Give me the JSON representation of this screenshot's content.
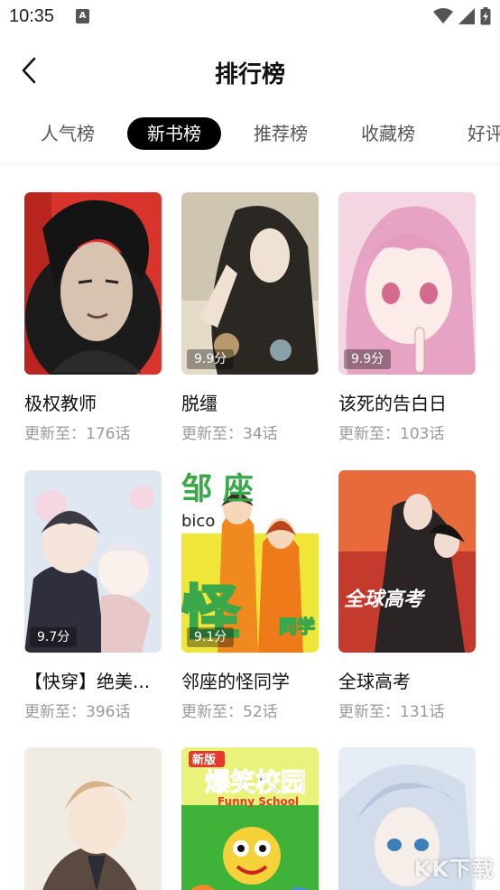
{
  "status_bar": {
    "time": "10:35",
    "notification_icon": "a-icon",
    "icons": [
      "wifi-icon",
      "signal-icon",
      "battery-icon"
    ]
  },
  "header": {
    "back_icon": "back-chevron-icon",
    "title": "排行榜"
  },
  "tabs": [
    {
      "label": "人气榜",
      "active": false
    },
    {
      "label": "新书榜",
      "active": true
    },
    {
      "label": "推荐榜",
      "active": false
    },
    {
      "label": "收藏榜",
      "active": false
    },
    {
      "label": "好评",
      "active": false
    }
  ],
  "comics": [
    {
      "title": "极权教师",
      "chapter": "更新至：176话",
      "score": ""
    },
    {
      "title": "脱缰",
      "chapter": "更新至：34话",
      "score": "9.9分"
    },
    {
      "title": "该死的告白日",
      "chapter": "更新至：103话",
      "score": "9.9分"
    },
    {
      "title": "【快穿】绝美...",
      "chapter": "更新至：396话",
      "score": "9.7分"
    },
    {
      "title": "邻座的怪同学",
      "chapter": "更新至：52话",
      "score": "9.1分"
    },
    {
      "title": "全球高考",
      "chapter": "更新至：131话",
      "score": ""
    },
    {
      "title": "",
      "chapter": "",
      "score": ""
    },
    {
      "title": "",
      "chapter": "",
      "score": ""
    },
    {
      "title": "",
      "chapter": "",
      "score": ""
    }
  ],
  "cover_text": {
    "c5_word": "bico",
    "c5_top": "邹 座",
    "c5_big": "怪",
    "c5_side": "同学",
    "c6_calligraphy": "全球高考",
    "c8_badge": "新版",
    "c8_title": "爆笑校园",
    "c8_sub": "Funny School"
  },
  "watermark": "KK下载",
  "colors": {
    "active_tab_bg": "#000000",
    "title_text": "#111111",
    "meta_text": "#999999"
  }
}
